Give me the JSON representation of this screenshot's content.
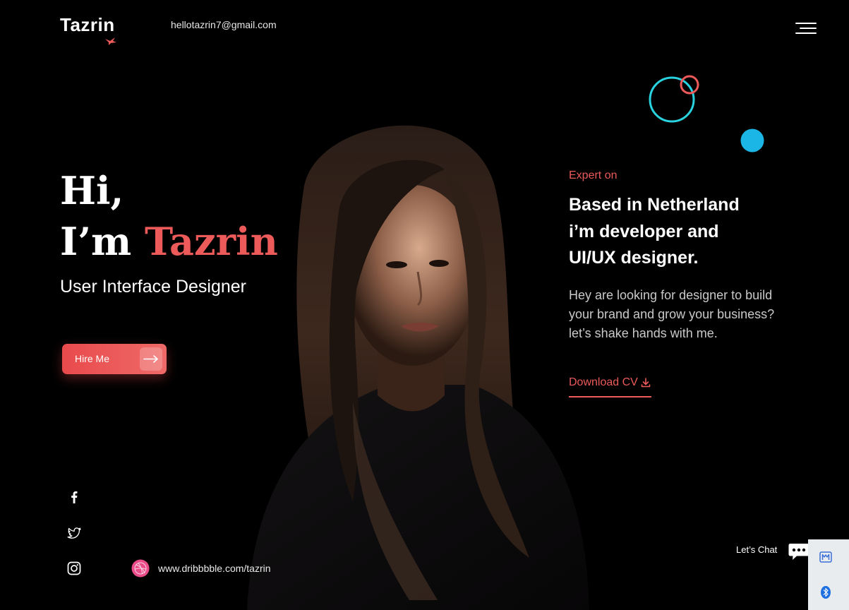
{
  "header": {
    "logo_text": "Tazrin",
    "email": "hellotazrin7@gmail.com",
    "menu_icon": "hamburger-icon"
  },
  "hero": {
    "greeting": "Hi,",
    "intro_prefix": "I’m ",
    "name": "Tazrin",
    "role": "User Interface Designer",
    "hire_label": "Hire Me"
  },
  "about": {
    "eyebrow": "Expert on",
    "headline": [
      "Based in Netherland",
      "i’m developer and",
      "UI/UX designer."
    ],
    "description": [
      "Hey are looking for designer to build",
      "your brand and grow your business?",
      "let’s shake hands with me."
    ],
    "download_label": "Download CV"
  },
  "socials": [
    {
      "name": "facebook",
      "icon": "facebook-icon"
    },
    {
      "name": "twitter",
      "icon": "twitter-icon"
    },
    {
      "name": "instagram",
      "icon": "instagram-icon"
    }
  ],
  "dribbble_url": "www.dribbbble.com/tazrin",
  "chat": {
    "label": "Let’s Chat"
  },
  "colors": {
    "accent": "#ec5a5a",
    "teal": "#28d3df",
    "blue": "#1bb6e6",
    "background": "#000000"
  }
}
